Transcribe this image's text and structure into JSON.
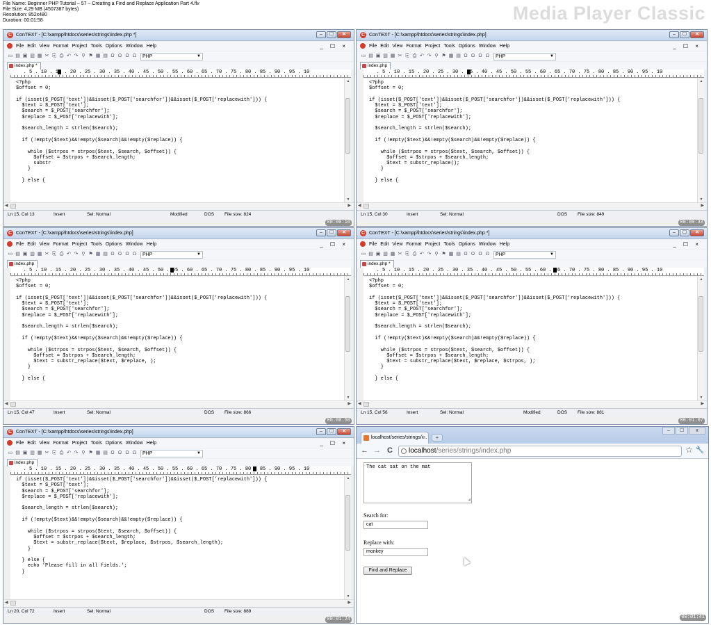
{
  "header": {
    "file_name": "File Name: Beginner PHP Tutorial – 57 – Creating a Find and Replace Application Part 4.flv",
    "file_size": "File Size: 4,29 MB (4507387 bytes)",
    "resolution": "Resolution: 852x480",
    "duration": "Duration: 00:01:58",
    "brand": "Media Player Classic"
  },
  "common": {
    "menus": [
      "File",
      "Edit",
      "View",
      "Format",
      "Project",
      "Tools",
      "Options",
      "Window",
      "Help"
    ],
    "menu_right": "_ ☐ ×",
    "language": "PHP",
    "ruler": "   . 5 . 10 . 15 . 20 . 25 . 30 . 35 . 40 . 45 . 50 . 55 . 60 . 65 . 70 . 75 . 80 . 85 . 90 . 95 . 10",
    "sel": "Sel: Normal",
    "dos": "DOS",
    "win_min": "–",
    "win_max": "☐",
    "win_close": "✕"
  },
  "panels": [
    {
      "title": "ConTEXT - [C:\\xampp\\htdocs\\series\\strings\\index.php *]",
      "tab": "index.php *",
      "ln_col": "Ln 15, Col 13",
      "mode": "Insert",
      "modified": "Modified",
      "file_size": "File size: 824",
      "timestamp": "00:00:16",
      "code": [
        "<?php",
        "$offset = 0;",
        "",
        "if (isset($_POST['text'])&&isset($_POST['searchfor'])&&isset($_POST['replacewith'])) {",
        "  $text = $_POST['text'];",
        "  $search = $_POST['searchfor'];",
        "  $replace = $_POST['replacewith'];",
        "",
        "  $search_length = strlen($search);",
        "",
        "  if (!empty($text)&&!empty($search)&&!empty($replace)) {",
        "",
        "    while ($strpos = strpos($text, $search, $offset)) {",
        "      $offset = $strpos + $search_length;",
        "      substr",
        "    }",
        "",
        "  } else {"
      ]
    },
    {
      "title": "ConTEXT - [C:\\xampp\\htdocs\\series\\strings\\index.php]",
      "tab": "index.php",
      "ln_col": "Ln 15, Col 30",
      "mode": "Insert",
      "modified": "",
      "file_size": "File size: 849",
      "timestamp": "00:00:33",
      "code": [
        "<?php",
        "$offset = 0;",
        "",
        "if (isset($_POST['text'])&&isset($_POST['searchfor'])&&isset($_POST['replacewith'])) {",
        "  $text = $_POST['text'];",
        "  $search = $_POST['searchfor'];",
        "  $replace = $_POST['replacewith'];",
        "",
        "  $search_length = strlen($search);",
        "",
        "  if (!empty($text)&&!empty($search)&&!empty($replace)) {",
        "",
        "    while ($strpos = strpos($text, $search, $offset)) {",
        "      $offset = $strpos + $search_length;",
        "      $text = substr_replace();",
        "    }",
        "",
        "  } else {"
      ]
    },
    {
      "title": "ConTEXT - [C:\\xampp\\htdocs\\series\\strings\\index.php]",
      "tab": "index.php",
      "ln_col": "Ln 15, Col 47",
      "mode": "Insert",
      "modified": "",
      "file_size": "File size: 866",
      "timestamp": "00:00:50",
      "code": [
        "<?php",
        "$offset = 0;",
        "",
        "if (isset($_POST['text'])&&isset($_POST['searchfor'])&&isset($_POST['replacewith'])) {",
        "  $text = $_POST['text'];",
        "  $search = $_POST['searchfor'];",
        "  $replace = $_POST['replacewith'];",
        "",
        "  $search_length = strlen($search);",
        "",
        "  if (!empty($text)&&!empty($search)&&!empty($replace)) {",
        "",
        "    while ($strpos = strpos($text, $search, $offset)) {",
        "      $offset = $strpos + $search_length;",
        "      $text = substr_replace($text, $replace, );",
        "    }",
        "",
        "  } else {"
      ]
    },
    {
      "title": "ConTEXT - [C:\\xampp\\htdocs\\series\\strings\\index.php *]",
      "tab": "index.php *",
      "ln_col": "Ln 15, Col 56",
      "mode": "Insert",
      "modified": "Modified",
      "file_size": "File size: 881",
      "timestamp": "00:01:07",
      "code": [
        "<?php",
        "$offset = 0;",
        "",
        "if (isset($_POST['text'])&&isset($_POST['searchfor'])&&isset($_POST['replacewith'])) {",
        "  $text = $_POST['text'];",
        "  $search = $_POST['searchfor'];",
        "  $replace = $_POST['replacewith'];",
        "",
        "  $search_length = strlen($search);",
        "",
        "  if (!empty($text)&&!empty($search)&&!empty($replace)) {",
        "",
        "    while ($strpos = strpos($text, $search, $offset)) {",
        "      $offset = $strpos + $search_length;",
        "      $text = substr_replace($text, $replace, $strpos, );",
        "    }",
        "",
        "  } else {"
      ]
    },
    {
      "title": "ConTEXT - [C:\\xampp\\htdocs\\series\\strings\\index.php]",
      "tab": "index.php",
      "ln_col": "Ln 20, Col 72",
      "mode": "Insert",
      "modified": "",
      "file_size": "File size: 889",
      "timestamp": "00:01:24",
      "code": [
        "if (isset($_POST['text'])&&isset($_POST['searchfor'])&&isset($_POST['replacewith'])) {",
        "  $text = $_POST['text'];",
        "  $search = $_POST['searchfor'];",
        "  $replace = $_POST['replacewith'];",
        "",
        "  $search_length = strlen($search);",
        "",
        "  if (!empty($text)&&!empty($search)&&!empty($replace)) {",
        "",
        "    while ($strpos = strpos($text, $search, $offset)) {",
        "      $offset = $strpos + $search_length;",
        "      $text = substr_replace($text, $replace, $strpos, $search_length);",
        "    }",
        "",
        "  } else {",
        "    echo 'Please fill in all fields.';",
        "  }",
        ""
      ]
    }
  ],
  "browser": {
    "tab_title": "localhost/series/strings/i...",
    "tab_close": "×",
    "new_tab": "+",
    "url_host": "localhost",
    "url_path": "/series/strings/index.php",
    "back": "←",
    "forward": "→",
    "reload": "C",
    "star": "☆",
    "wrench": "🔧",
    "textarea": "The cat sat on the mat",
    "search_label": "Search for:",
    "search_value": "cat",
    "replace_label": "Replace with:",
    "replace_value": "monkey",
    "button": "Find and Replace",
    "timestamp": "00:01:41",
    "win_min": "–",
    "win_max": "☐",
    "win_close": "x"
  }
}
